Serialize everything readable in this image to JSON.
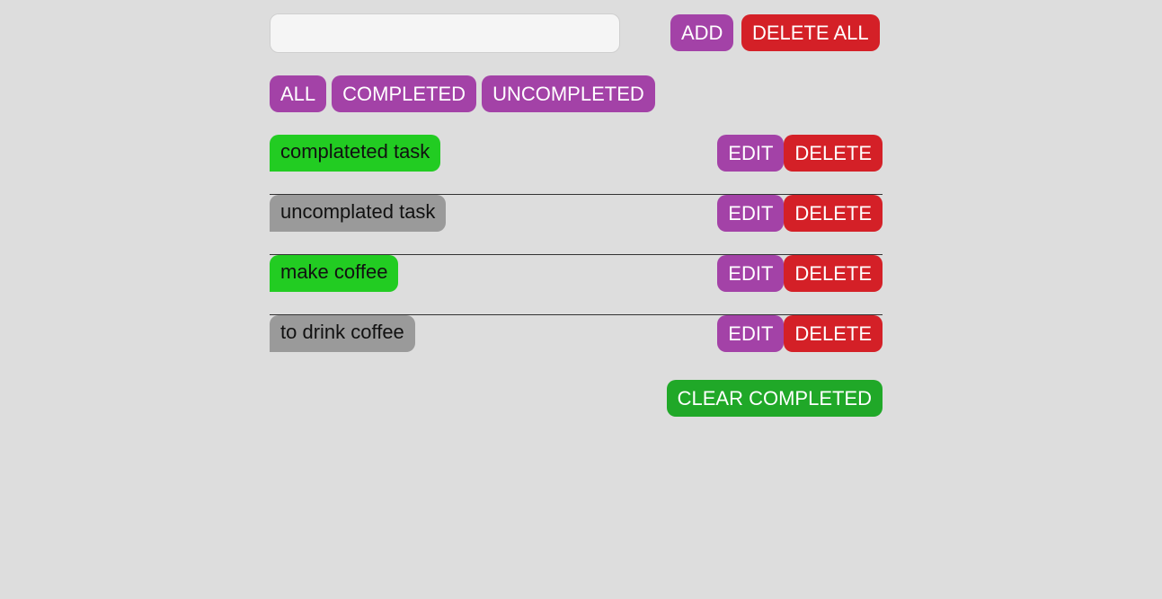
{
  "header": {
    "input_value": "",
    "input_placeholder": "",
    "add_label": "ADD",
    "delete_all_label": "DELETE ALL"
  },
  "filters": {
    "all": "ALL",
    "completed": "COMPLETED",
    "uncompleted": "UNCOMPLETED"
  },
  "tasks": [
    {
      "text": "complateted task",
      "completed": true
    },
    {
      "text": "uncomplated task",
      "completed": false
    },
    {
      "text": "make coffee",
      "completed": true
    },
    {
      "text": "to drink coffee",
      "completed": false
    }
  ],
  "actions": {
    "edit_label": "EDIT",
    "delete_label": "DELETE"
  },
  "footer": {
    "clear_completed_label": "CLEAR COMPLETED"
  },
  "colors": {
    "background": "#dddddd",
    "purple": "#a342a7",
    "red": "#d42027",
    "green_button": "#20a828",
    "completed_task": "#22cc22",
    "uncompleted_task": "#9a9a9a"
  }
}
